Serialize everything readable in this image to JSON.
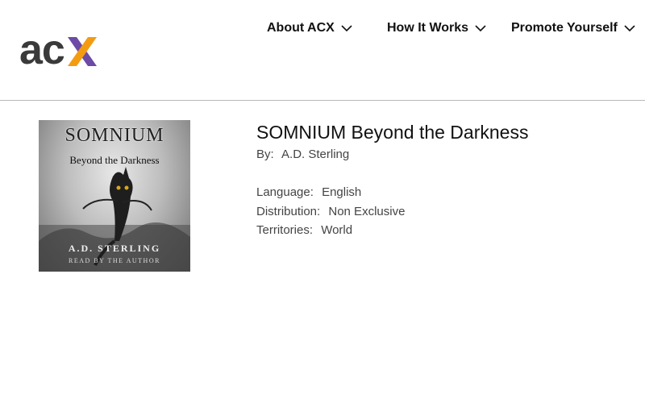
{
  "logo": {
    "ac": "ac",
    "x_color": "#f39c12",
    "x_color2": "#6d4aa5"
  },
  "nav": [
    {
      "label": "About ACX"
    },
    {
      "label": "How It Works"
    },
    {
      "label": "Promote Yourself"
    }
  ],
  "cover": {
    "title": "SOMNIUM",
    "subtitle": "Beyond the Darkness",
    "author": "A.D. STERLING",
    "reader": "READ BY THE AUTHOR"
  },
  "book": {
    "title": "SOMNIUM Beyond the Darkness",
    "by_label": "By:",
    "by_value": "A.D. Sterling",
    "language_label": "Language:",
    "language_value": "English",
    "distribution_label": "Distribution:",
    "distribution_value": "Non Exclusive",
    "territories_label": "Territories:",
    "territories_value": "World"
  }
}
